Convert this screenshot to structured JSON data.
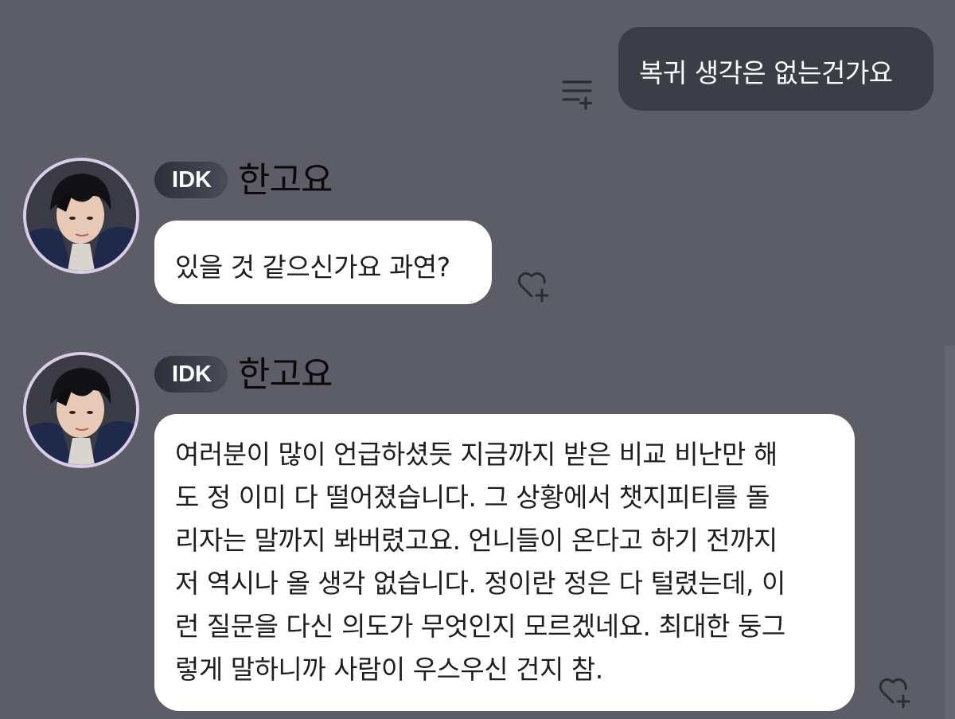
{
  "sent_message": {
    "text": "복귀 생각은 없는건가요"
  },
  "messages": [
    {
      "badge": "IDK",
      "sender": "한고요",
      "text": "있을 것 같으신가요 과연?"
    },
    {
      "badge": "IDK",
      "sender": "한고요",
      "text": "여러분이 많이 언급하셨듯 지금까지 받은 비교 비난만 해\n도 정 이미 다 떨어졌습니다. 그 상황에서 챗지피티를 돌\n리자는 말까지 봐버렸고요. 언니들이 온다고 하기 전까지\n저 역시나 올 생각 없습니다. 정이란 정은 다 털렸는데, 이\n런 질문을 다신 의도가 무엇인지 모르겠네요. 최대한 둥그\n렇게 말하니까 사람이 우스우신 건지 참."
    }
  ],
  "icons": {
    "menu_add": "menu-add-icon",
    "heart_add": "heart-add-icon",
    "avatar": "avatar"
  },
  "colors": {
    "background": "#5c5d67",
    "sent_bubble": "#3b3e47",
    "received_bubble": "#ffffff",
    "avatar_ring": "#d9cdea"
  }
}
